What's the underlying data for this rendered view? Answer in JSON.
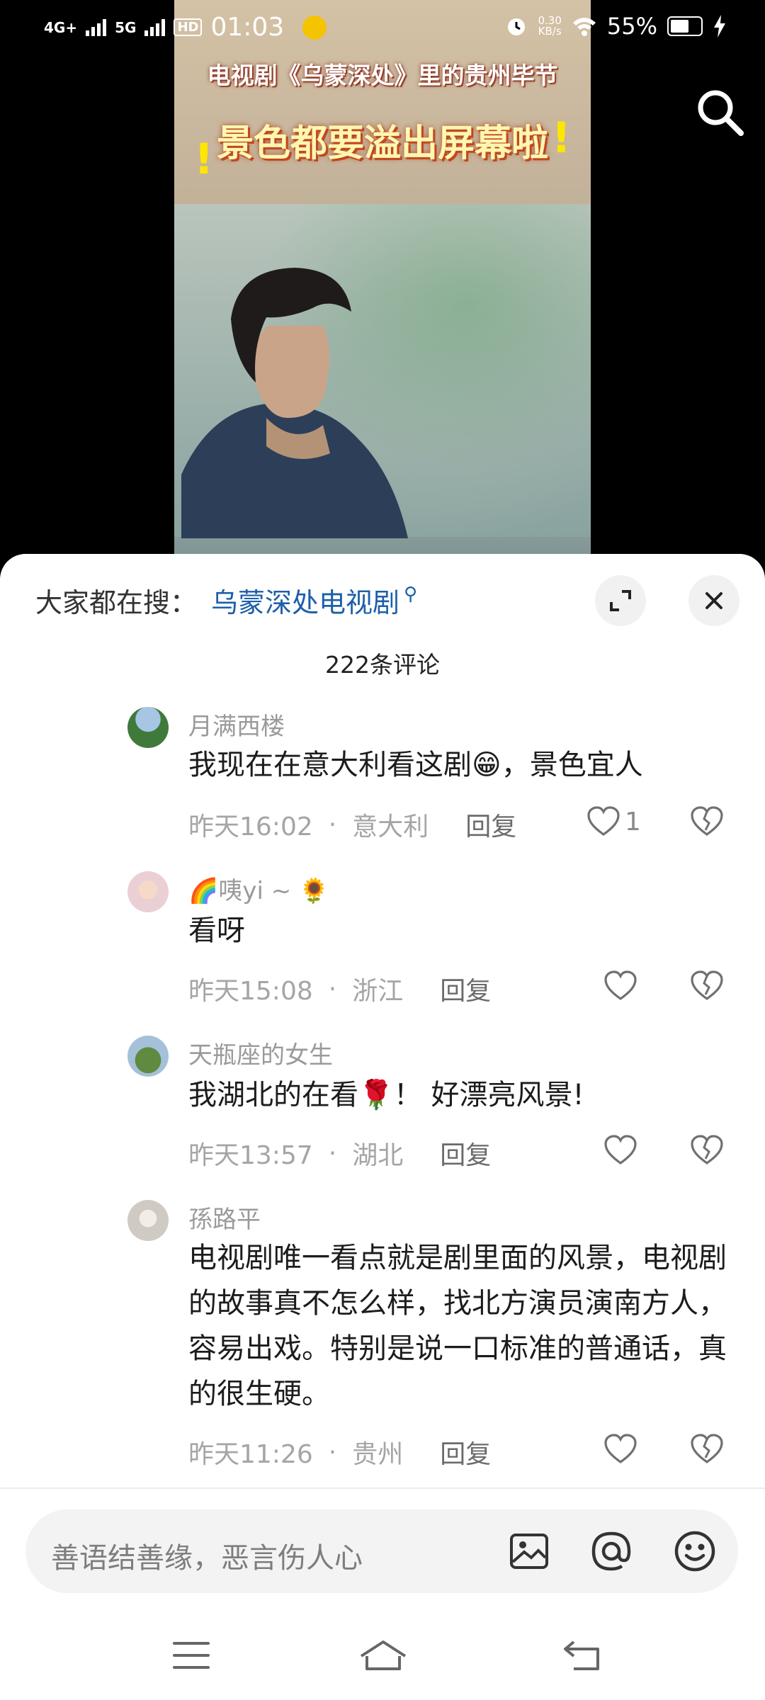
{
  "status_bar": {
    "signal1": "4G+",
    "signal2": "5G",
    "hd": "HD",
    "time": "01:03",
    "speed_value": "0.30",
    "speed_unit": "KB/s",
    "battery": "55%",
    "battery_level": 0.55
  },
  "video": {
    "title_line1": "电视剧《乌蒙深处》里的贵州毕节",
    "title_line2": "景色都要溢出屏幕啦"
  },
  "sheet": {
    "hot_label": "大家都在搜：",
    "hot_keyword": "乌蒙深处电视剧",
    "count_label": "222条评论"
  },
  "comments": [
    {
      "name": "月满西楼",
      "text": "我现在在意大利看这剧😁，景色宜人",
      "time": "昨天16:02",
      "location": "意大利",
      "reply": "回复",
      "likes": "1"
    },
    {
      "name": "🌈咦yi ~ 🌻",
      "text": "看呀",
      "time": "昨天15:08",
      "location": "浙江",
      "reply": "回复",
      "likes": ""
    },
    {
      "name": "天瓶座的女生",
      "text": "我湖北的在看🌹！ 好漂亮风景!",
      "time": "昨天13:57",
      "location": "湖北",
      "reply": "回复",
      "likes": ""
    },
    {
      "name": "孫路平",
      "text": "电视剧唯一看点就是剧里面的风景，电视剧的故事真不怎么样，找北方演员演南方人，容易出戏。特别是说一口标准的普通话，真的很生硬。",
      "time": "昨天11:26",
      "location": "贵州",
      "reply": "回复",
      "likes": ""
    }
  ],
  "input_bar": {
    "placeholder": "善语结善缘，恶言伤人心",
    "icons": [
      "image-icon",
      "at-icon",
      "emoji-icon"
    ]
  },
  "nav_bar": {
    "icons": [
      "menu-icon",
      "home-icon",
      "back-icon"
    ]
  }
}
